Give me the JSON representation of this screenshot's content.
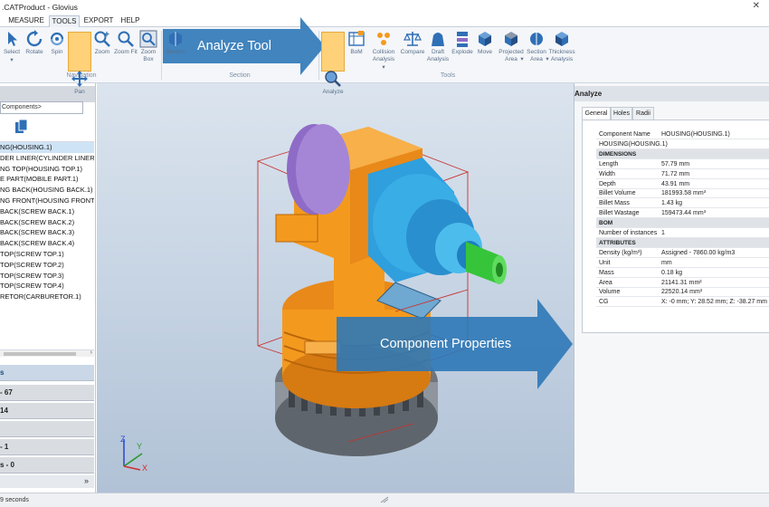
{
  "window": {
    "title": ".CATProduct - Glovius",
    "close_glyph": "✕"
  },
  "menu": [
    {
      "label": "MEASURE",
      "active": false
    },
    {
      "label": "TOOLS",
      "active": true
    },
    {
      "label": "EXPORT",
      "active": false
    },
    {
      "label": "HELP",
      "active": false
    }
  ],
  "ribbon": {
    "navigation": {
      "group": "Navigation",
      "buttons": [
        "Select",
        "Rotate",
        "Spin",
        "Pan",
        "Zoom",
        "Zoom Fit",
        "Zoom Box"
      ],
      "selected": "Pan"
    },
    "section": {
      "group": "Section",
      "buttons": [
        "Section"
      ]
    },
    "tools": {
      "group": "Tools",
      "buttons": [
        "Analyze",
        "BoM",
        "Collision Analysis",
        "Compare",
        "Draft Analysis",
        "Explode",
        "Move",
        "Projected Area",
        "Section Area",
        "Thickness Analysis"
      ],
      "selected": "Analyze"
    }
  },
  "callouts": {
    "analyze_tool": "Analyze Tool",
    "component_properties": "Component Properties"
  },
  "left_panel": {
    "search_text": "Components>",
    "tree": [
      "NG(HOUSING.1)",
      "DER LINER(CYLINDER LINER.1)",
      "NG TOP(HOUSING TOP.1)",
      "E PART(MOBILE PART.1)",
      "NG BACK(HOUSING BACK.1)",
      "NG FRONT(HOUSING FRONT.1)",
      "BACK(SCREW BACK.1)",
      "BACK(SCREW BACK.2)",
      "BACK(SCREW BACK.3)",
      "BACK(SCREW BACK.4)",
      "TOP(SCREW TOP.1)",
      "TOP(SCREW TOP.2)",
      "TOP(SCREW TOP.3)",
      "TOP(SCREW TOP.4)",
      "RETOR(CARBURETOR.1)"
    ],
    "accordion": [
      "s",
      "- 67",
      "14",
      "",
      "- 1",
      "s - 0"
    ],
    "more_glyph": "»"
  },
  "axes": {
    "x": "X",
    "y": "Y",
    "z": "Z"
  },
  "analyze_panel": {
    "title": "Analyze",
    "tabs": [
      "General",
      "Holes",
      "Radii"
    ],
    "rows": [
      {
        "k": "Component Name",
        "v": "HOUSING(HOUSING.1)"
      },
      {
        "k": "HOUSING(HOUSING.1)",
        "v": ""
      },
      {
        "k": "DIMENSIONS",
        "v": "",
        "section": true
      },
      {
        "k": "Length",
        "v": "57.79 mm"
      },
      {
        "k": "Width",
        "v": "71.72 mm"
      },
      {
        "k": "Depth",
        "v": "43.91 mm"
      },
      {
        "k": "Billet Volume",
        "v": "181993.58 mm³"
      },
      {
        "k": "Billet Mass",
        "v": "1.43 kg"
      },
      {
        "k": "Billet Wastage",
        "v": "159473.44 mm³"
      },
      {
        "k": "BOM",
        "v": "",
        "section": true
      },
      {
        "k": "Number of instances",
        "v": "1"
      },
      {
        "k": "ATTRIBUTES",
        "v": "",
        "section": true
      },
      {
        "k": "Density (kg/m³)",
        "v": "Assigned - 7860.00 kg/m3"
      },
      {
        "k": "Unit",
        "v": "mm"
      },
      {
        "k": "Mass",
        "v": "0.18 kg"
      },
      {
        "k": "Area",
        "v": "21141.31 mm²"
      },
      {
        "k": "Volume",
        "v": "22520.14 mm³"
      },
      {
        "k": "CG",
        "v": "X: -0 mm; Y: 28.52 mm; Z: -38.27 mm"
      }
    ]
  },
  "status": {
    "text": "9 seconds"
  },
  "colors": {
    "accent": "#2e78b7",
    "selected_button": "#ffd27a",
    "model_orange": "#f39a1e",
    "model_blue": "#2f9fdd",
    "model_purple": "#8e6bc6",
    "model_green": "#36c53a",
    "model_grey": "#8f959d"
  }
}
